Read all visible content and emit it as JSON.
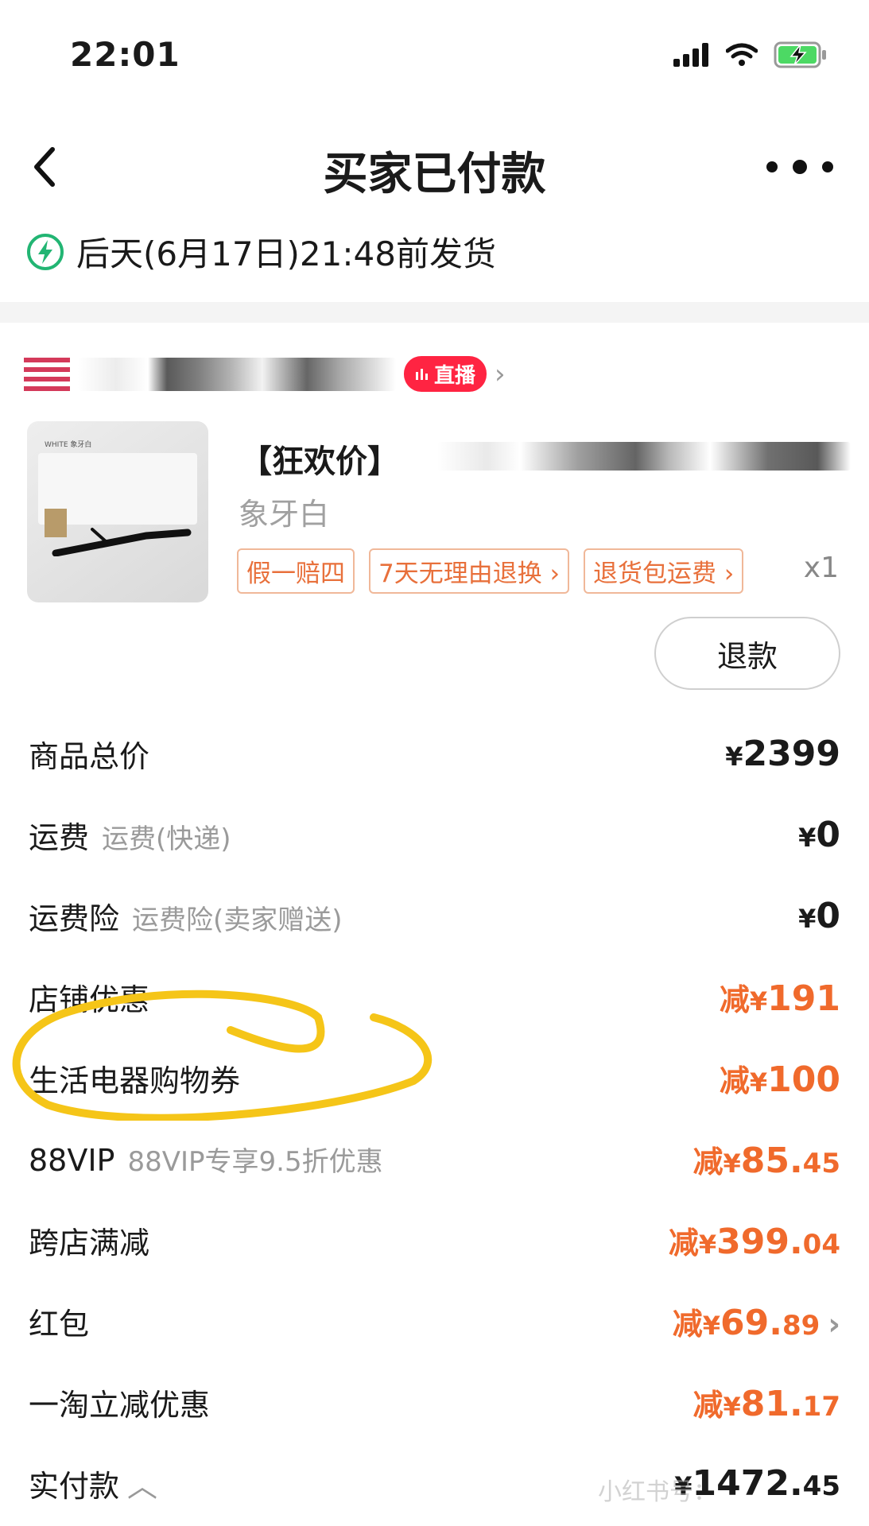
{
  "status_bar": {
    "time": "22:01"
  },
  "nav": {
    "title": "买家已付款",
    "back_icon": "chevron-left-icon",
    "more_icon": "more-icon"
  },
  "shipping": {
    "text": "后天(6月17日)21:48前发货",
    "icon": "lightning-icon"
  },
  "shop": {
    "live_label": "直播"
  },
  "product": {
    "title": "【狂欢价】",
    "variant": "象牙白",
    "tags": [
      "假一赔四",
      "7天无理由退换 ›",
      "退货包运费 ›"
    ],
    "quantity": "x1",
    "refund_button": "退款",
    "thumb_text": "WHITE 象牙白"
  },
  "rows": [
    {
      "label": "商品总价",
      "sub": "",
      "prefix": "",
      "currency": "¥",
      "int": "2399",
      "dec": ""
    },
    {
      "label": "运费",
      "sub": "运费(快递)",
      "prefix": "",
      "currency": "¥",
      "int": "0",
      "dec": ""
    },
    {
      "label": "运费险",
      "sub": "运费险(卖家赠送)",
      "prefix": "",
      "currency": "¥",
      "int": "0",
      "dec": ""
    },
    {
      "label": "店铺优惠",
      "sub": "",
      "prefix": "减",
      "currency": "¥",
      "int": "191",
      "dec": ""
    },
    {
      "label": "生活电器购物券",
      "sub": "",
      "prefix": "减",
      "currency": "¥",
      "int": "100",
      "dec": ""
    },
    {
      "label": "88VIP",
      "sub": "88VIP专享9.5折优惠",
      "prefix": "减",
      "currency": "¥",
      "int": "85.",
      "dec": "45"
    },
    {
      "label": "跨店满减",
      "sub": "",
      "prefix": "减",
      "currency": "¥",
      "int": "399.",
      "dec": "04"
    },
    {
      "label": "红包",
      "sub": "",
      "prefix": "减",
      "currency": "¥",
      "int": "69.",
      "dec": "89"
    },
    {
      "label": "一淘立减优惠",
      "sub": "",
      "prefix": "减",
      "currency": "¥",
      "int": "81.",
      "dec": "17"
    },
    {
      "label": "实付款",
      "sub": "",
      "prefix": "",
      "currency": "¥",
      "int": "1472.",
      "dec": "45"
    }
  ],
  "watermark": "小红书号：",
  "colors": {
    "accent": "#f06a2c",
    "live_badge": "#ff2442",
    "annotation": "#f5c518"
  }
}
